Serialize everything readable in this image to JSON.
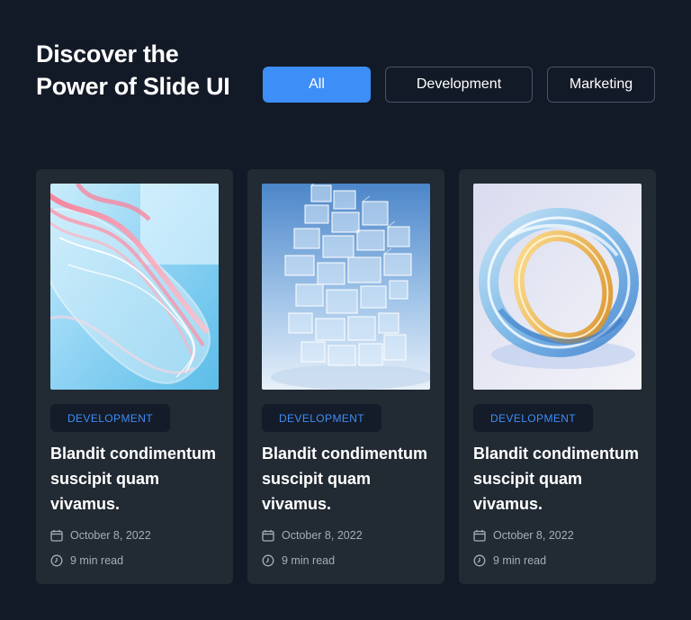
{
  "header": {
    "title": "Discover the Power of Slide UI"
  },
  "filters": [
    {
      "label": "All",
      "active": true
    },
    {
      "label": "Development",
      "active": false
    },
    {
      "label": "Marketing",
      "active": false
    }
  ],
  "cards": [
    {
      "tag": "DEVELOPMENT",
      "title": "Blandit condimentum suscipit quam vivamus.",
      "date": "October 8, 2022",
      "read_time": "9 min read",
      "image": "abstract glass waves"
    },
    {
      "tag": "DEVELOPMENT",
      "title": "Blandit condimentum suscipit quam vivamus.",
      "date": "October 8, 2022",
      "read_time": "9 min read",
      "image": "glass cubes tower"
    },
    {
      "tag": "DEVELOPMENT",
      "title": "Blandit condimentum suscipit quam vivamus.",
      "date": "October 8, 2022",
      "read_time": "9 min read",
      "image": "glass ring"
    }
  ],
  "colors": {
    "background": "#131a27",
    "card": "#222a33",
    "accent": "#3d8ef6",
    "tag_background": "#141b29",
    "meta_text": "#a7adb7"
  },
  "icons": {
    "date": "calendar-icon",
    "read_time": "clock-icon"
  }
}
